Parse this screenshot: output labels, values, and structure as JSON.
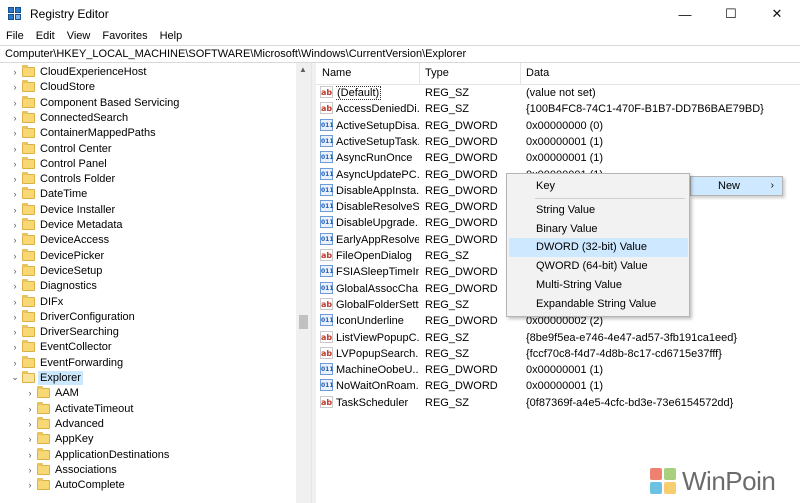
{
  "window": {
    "title": "Registry Editor",
    "controls": {
      "minimize": "—",
      "maximize": "☐",
      "close": "✕"
    }
  },
  "menu": [
    "File",
    "Edit",
    "View",
    "Favorites",
    "Help"
  ],
  "address": "Computer\\HKEY_LOCAL_MACHINE\\SOFTWARE\\Microsoft\\Windows\\CurrentVersion\\Explorer",
  "tree": {
    "items": [
      {
        "label": "CloudExperienceHost",
        "level": 0,
        "expander": "›"
      },
      {
        "label": "CloudStore",
        "level": 0,
        "expander": "›"
      },
      {
        "label": "Component Based Servicing",
        "level": 0,
        "expander": "›"
      },
      {
        "label": "ConnectedSearch",
        "level": 0,
        "expander": "›"
      },
      {
        "label": "ContainerMappedPaths",
        "level": 0,
        "expander": "›"
      },
      {
        "label": "Control Center",
        "level": 0,
        "expander": "›"
      },
      {
        "label": "Control Panel",
        "level": 0,
        "expander": "›"
      },
      {
        "label": "Controls Folder",
        "level": 0,
        "expander": "›"
      },
      {
        "label": "DateTime",
        "level": 0,
        "expander": "›"
      },
      {
        "label": "Device Installer",
        "level": 0,
        "expander": "›"
      },
      {
        "label": "Device Metadata",
        "level": 0,
        "expander": "›"
      },
      {
        "label": "DeviceAccess",
        "level": 0,
        "expander": "›"
      },
      {
        "label": "DevicePicker",
        "level": 0,
        "expander": "›"
      },
      {
        "label": "DeviceSetup",
        "level": 0,
        "expander": "›"
      },
      {
        "label": "Diagnostics",
        "level": 0,
        "expander": "›"
      },
      {
        "label": "DIFx",
        "level": 0,
        "expander": "›"
      },
      {
        "label": "DriverConfiguration",
        "level": 0,
        "expander": "›"
      },
      {
        "label": "DriverSearching",
        "level": 0,
        "expander": "›"
      },
      {
        "label": "EventCollector",
        "level": 0,
        "expander": "›"
      },
      {
        "label": "EventForwarding",
        "level": 0,
        "expander": "›"
      },
      {
        "label": "Explorer",
        "level": 0,
        "expander": "⌄",
        "selected": true,
        "open": true
      },
      {
        "label": "AAM",
        "level": 1,
        "expander": "›"
      },
      {
        "label": "ActivateTimeout",
        "level": 1,
        "expander": "›"
      },
      {
        "label": "Advanced",
        "level": 1,
        "expander": "›"
      },
      {
        "label": "AppKey",
        "level": 1,
        "expander": "›"
      },
      {
        "label": "ApplicationDestinations",
        "level": 1,
        "expander": "›"
      },
      {
        "label": "Associations",
        "level": 1,
        "expander": "›"
      },
      {
        "label": "AutoComplete",
        "level": 1,
        "expander": "›"
      }
    ]
  },
  "list": {
    "headers": {
      "name": "Name",
      "type": "Type",
      "data": "Data"
    },
    "rows": [
      {
        "icon": "ab",
        "kind": "sz",
        "name": "(Default)",
        "type": "REG_SZ",
        "data": "(value not set)"
      },
      {
        "icon": "ab",
        "kind": "sz",
        "name": "AccessDeniedDi...",
        "type": "REG_SZ",
        "data": "{100B4FC8-74C1-470F-B1B7-DD7B6BAE79BD}"
      },
      {
        "icon": "011",
        "kind": "dw",
        "name": "ActiveSetupDisa...",
        "type": "REG_DWORD",
        "data": "0x00000000 (0)"
      },
      {
        "icon": "011",
        "kind": "dw",
        "name": "ActiveSetupTask...",
        "type": "REG_DWORD",
        "data": "0x00000001 (1)"
      },
      {
        "icon": "011",
        "kind": "dw",
        "name": "AsyncRunOnce",
        "type": "REG_DWORD",
        "data": "0x00000001 (1)"
      },
      {
        "icon": "011",
        "kind": "dw",
        "name": "AsyncUpdatePC...",
        "type": "REG_DWORD",
        "data": "0x00000001 (1)"
      },
      {
        "icon": "011",
        "kind": "dw",
        "name": "DisableAppInsta...",
        "type": "REG_DWORD",
        "data": ""
      },
      {
        "icon": "011",
        "kind": "dw",
        "name": "DisableResolveS...",
        "type": "REG_DWORD",
        "data": ""
      },
      {
        "icon": "011",
        "kind": "dw",
        "name": "DisableUpgrade...",
        "type": "REG_DWORD",
        "data": ""
      },
      {
        "icon": "011",
        "kind": "dw",
        "name": "EarlyAppResolve...",
        "type": "REG_DWORD",
        "data": ""
      },
      {
        "icon": "ab",
        "kind": "sz",
        "name": "FileOpenDialog",
        "type": "REG_SZ",
        "data": "A20AEF7}"
      },
      {
        "icon": "011",
        "kind": "dw",
        "name": "FSIASleepTimeIn...",
        "type": "REG_DWORD",
        "data": ""
      },
      {
        "icon": "011",
        "kind": "dw",
        "name": "GlobalAssocCha...",
        "type": "REG_DWORD",
        "data": ""
      },
      {
        "icon": "ab",
        "kind": "sz",
        "name": "GlobalFolderSett...",
        "type": "REG_SZ",
        "data": "7DF8C11}"
      },
      {
        "icon": "011",
        "kind": "dw",
        "name": "IconUnderline",
        "type": "REG_DWORD",
        "data": "0x00000002 (2)"
      },
      {
        "icon": "ab",
        "kind": "sz",
        "name": "ListViewPopupC...",
        "type": "REG_SZ",
        "data": "{8be9f5ea-e746-4e47-ad57-3fb191ca1eed}"
      },
      {
        "icon": "ab",
        "kind": "sz",
        "name": "LVPopupSearch...",
        "type": "REG_SZ",
        "data": "{fccf70c8-f4d7-4d8b-8c17-cd6715e37fff}"
      },
      {
        "icon": "011",
        "kind": "dw",
        "name": "MachineOobeU...",
        "type": "REG_DWORD",
        "data": "0x00000001 (1)"
      },
      {
        "icon": "011",
        "kind": "dw",
        "name": "NoWaitOnRoam...",
        "type": "REG_DWORD",
        "data": "0x00000001 (1)"
      },
      {
        "icon": "ab",
        "kind": "sz",
        "name": "TaskScheduler",
        "type": "REG_SZ",
        "data": "{0f87369f-a4e5-4cfc-bd3e-73e6154572dd}"
      }
    ]
  },
  "context_menu": {
    "new_label": "New",
    "new_arrow": "›",
    "items": [
      "Key",
      "String Value",
      "Binary Value",
      "DWORD (32-bit) Value",
      "QWORD (64-bit) Value",
      "Multi-String Value",
      "Expandable String Value"
    ],
    "highlighted_item": "DWORD (32-bit) Value"
  },
  "watermark": {
    "text": "WinPoin"
  },
  "colors": {
    "selection": "#cce8ff",
    "menu_highlight": "#cde8ff",
    "folder": "#f8d775"
  }
}
